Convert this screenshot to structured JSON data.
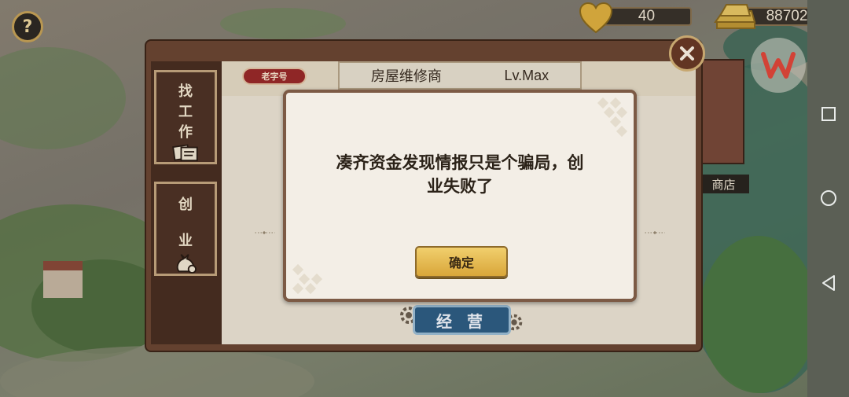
{
  "hud": {
    "help_symbol": "?",
    "hearts": "40",
    "gold": "88702"
  },
  "map": {
    "shop_label": "商店"
  },
  "sidebar": {
    "tab_job": [
      "找",
      "工",
      "作"
    ],
    "tab_biz": [
      "创",
      "业"
    ]
  },
  "panel": {
    "tag": "老字号",
    "title": "房屋维修商",
    "level": "Lv.Max",
    "manage_label": "经 营"
  },
  "dialog": {
    "message_line1": "凑齐资金发现情报只是个骗局，创",
    "message_line2": "业失败了",
    "confirm_label": "确定"
  },
  "colors": {
    "panel_brown": "#6d4733",
    "confirm_gold": "#e8bb52",
    "manage_blue": "#2f5f86",
    "tag_red": "#9c2a2a"
  },
  "icons": [
    "help-icon",
    "heart-icon",
    "gold-bars-icon",
    "wps-icon",
    "close-icon",
    "job-papers-icon",
    "money-bag-icon",
    "gear-icon",
    "nav-recents-icon",
    "nav-home-icon",
    "nav-back-icon"
  ]
}
